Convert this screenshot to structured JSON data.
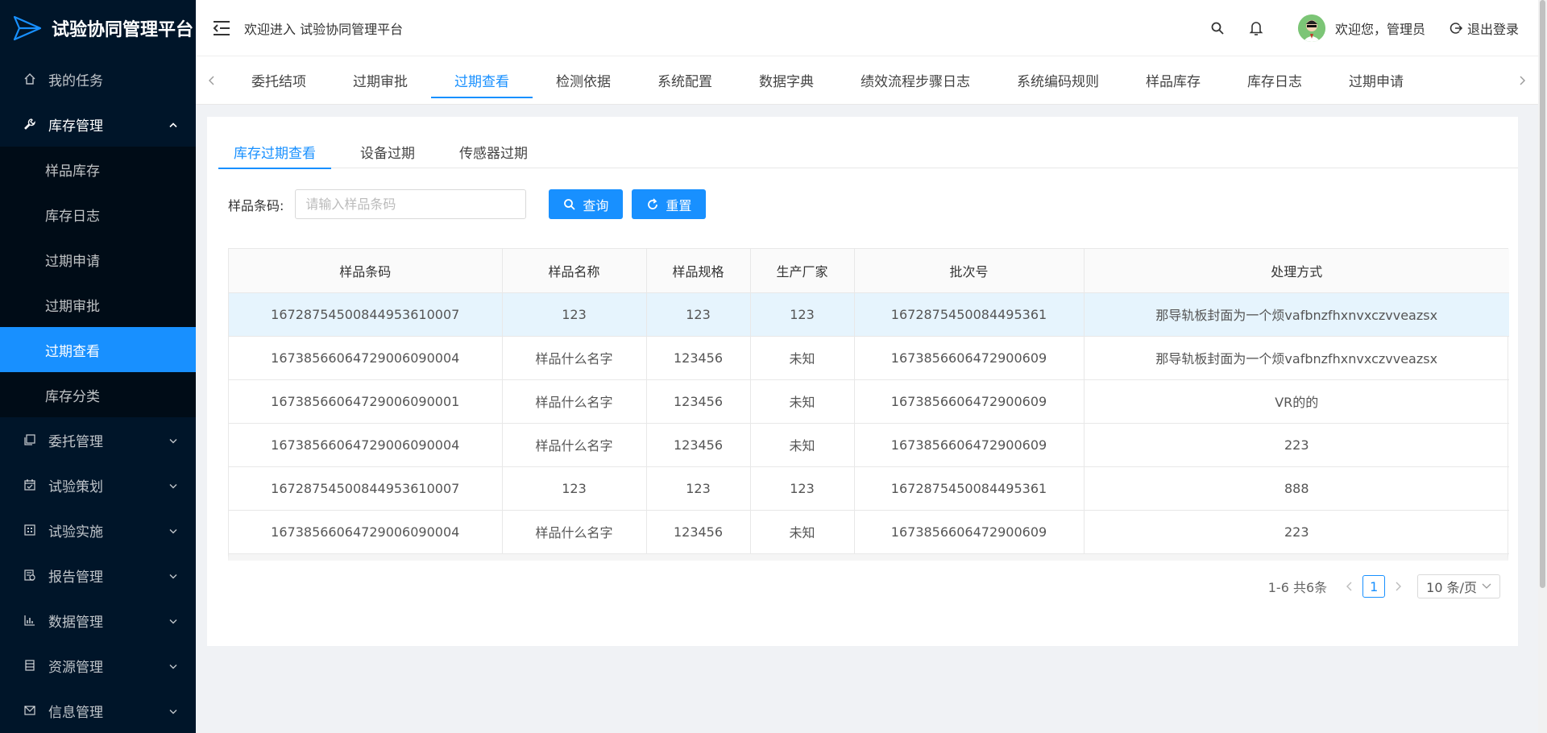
{
  "app": {
    "title": "试验协同管理平台"
  },
  "sidebar": {
    "items": [
      {
        "label": "我的任务",
        "icon": "home-icon"
      },
      {
        "label": "库存管理",
        "icon": "wrench-icon",
        "open": true,
        "children": [
          "样品库存",
          "库存日志",
          "过期申请",
          "过期审批",
          "过期查看",
          "库存分类"
        ],
        "active_child": "过期查看"
      },
      {
        "label": "委托管理",
        "icon": "copy-icon"
      },
      {
        "label": "试验策划",
        "icon": "calendar-icon"
      },
      {
        "label": "试验实施",
        "icon": "grid-icon"
      },
      {
        "label": "报告管理",
        "icon": "report-icon"
      },
      {
        "label": "数据管理",
        "icon": "bar-chart-icon"
      },
      {
        "label": "资源管理",
        "icon": "database-icon"
      },
      {
        "label": "信息管理",
        "icon": "mail-icon"
      }
    ]
  },
  "header": {
    "welcome": "欢迎进入 试验协同管理平台",
    "user_greeting": "欢迎您，管理员",
    "logout": "退出登录"
  },
  "tabs": [
    "委托结项",
    "过期审批",
    "过期查看",
    "检测依据",
    "系统配置",
    "数据字典",
    "绩效流程步骤日志",
    "系统编码规则",
    "样品库存",
    "库存日志",
    "过期申请"
  ],
  "active_tab": "过期查看",
  "inner_tabs": [
    "库存过期查看",
    "设备过期",
    "传感器过期"
  ],
  "active_inner_tab": "库存过期查看",
  "search": {
    "label": "样品条码:",
    "placeholder": "请输入样品条码",
    "query_label": "查询",
    "reset_label": "重置"
  },
  "table": {
    "columns": [
      "样品条码",
      "样品名称",
      "样品规格",
      "生产厂家",
      "批次号",
      "处理方式"
    ],
    "rows": [
      [
        "16728754500844953610007",
        "123",
        "123",
        "123",
        "1672875450084495361",
        "那导轨板封面为一个烦vafbnzfhxnvxczvveazsx"
      ],
      [
        "16738566064729006090004",
        "样品什么名字",
        "123456",
        "未知",
        "1673856606472900609",
        "那导轨板封面为一个烦vafbnzfhxnvxczvveazsx"
      ],
      [
        "16738566064729006090001",
        "样品什么名字",
        "123456",
        "未知",
        "1673856606472900609",
        "VR的的"
      ],
      [
        "16738566064729006090004",
        "样品什么名字",
        "123456",
        "未知",
        "1673856606472900609",
        "223"
      ],
      [
        "16728754500844953610007",
        "123",
        "123",
        "123",
        "1672875450084495361",
        "888"
      ],
      [
        "16738566064729006090004",
        "样品什么名字",
        "123456",
        "未知",
        "1673856606472900609",
        "223"
      ]
    ]
  },
  "pagination": {
    "total_text": "1-6 共6条",
    "current_page": "1",
    "page_size": "10 条/页"
  },
  "colors": {
    "primary": "#1890ff",
    "sidebar_bg": "#001529"
  }
}
